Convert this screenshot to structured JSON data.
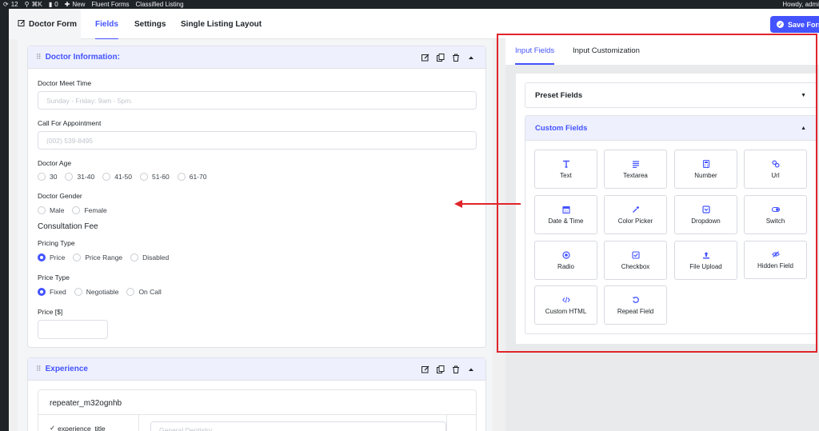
{
  "admin_bar": {
    "updates": "12",
    "shortcut": "⌘K",
    "comments": "0",
    "new": "New",
    "fluent": "Fluent Forms",
    "classified": "Classified Listing",
    "howdy": "Howdy, admi"
  },
  "header": {
    "form_title": "Doctor Form",
    "tabs": [
      {
        "label": "Fields"
      },
      {
        "label": "Settings"
      },
      {
        "label": "Single Listing Layout"
      }
    ],
    "save_label": "Save Form"
  },
  "doctor_section": {
    "title": "Doctor Information:",
    "meet_time_label": "Doctor Meet Time",
    "meet_time_placeholder": "Sunday - Friday: 9am - 5pm.",
    "appointment_label": "Call For Appointment",
    "appointment_placeholder": "(002) 539-8495",
    "age_label": "Doctor Age",
    "age_options": [
      "30",
      "31-40",
      "41-50",
      "51-60",
      "61-70"
    ],
    "gender_label": "Doctor Gender",
    "gender_options": [
      "Male",
      "Female"
    ],
    "fee_heading": "Consultation Fee",
    "pricing_type_label": "Pricing Type",
    "pricing_type_options": [
      "Price",
      "Price Range",
      "Disabled"
    ],
    "pricing_type_selected": "Price",
    "price_type_label": "Price Type",
    "price_type_options": [
      "Fixed",
      "Negotiable",
      "On Call"
    ],
    "price_type_selected": "Fixed",
    "price_label": "Price [$]"
  },
  "experience_section": {
    "title": "Experience",
    "repeater_name": "repeater_m32ognhb",
    "row_label": "experience_title",
    "row_placeholder": "General Dentistry"
  },
  "right_panel": {
    "tabs": [
      {
        "label": "Input Fields"
      },
      {
        "label": "Input Customization"
      }
    ],
    "preset_title": "Preset Fields",
    "custom_title": "Custom Fields",
    "custom_fields": [
      {
        "label": "Text",
        "icon": "text-icon"
      },
      {
        "label": "Textarea",
        "icon": "textarea-icon"
      },
      {
        "label": "Number",
        "icon": "number-icon"
      },
      {
        "label": "Url",
        "icon": "link-icon"
      },
      {
        "label": "Date & Time",
        "icon": "calendar-icon"
      },
      {
        "label": "Color Picker",
        "icon": "eyedropper-icon"
      },
      {
        "label": "Dropdown",
        "icon": "dropdown-icon"
      },
      {
        "label": "Switch",
        "icon": "toggle-icon"
      },
      {
        "label": "Radio",
        "icon": "radio-icon"
      },
      {
        "label": "Checkbox",
        "icon": "checkbox-icon"
      },
      {
        "label": "File Upload",
        "icon": "upload-icon"
      },
      {
        "label": "Hidden Field",
        "icon": "eye-slash-icon"
      },
      {
        "label": "Custom HTML",
        "icon": "code-icon"
      },
      {
        "label": "Repeat Field",
        "icon": "repeat-icon"
      }
    ]
  },
  "colors": {
    "accent": "#4353ff",
    "annotation_red": "#e0242b"
  }
}
